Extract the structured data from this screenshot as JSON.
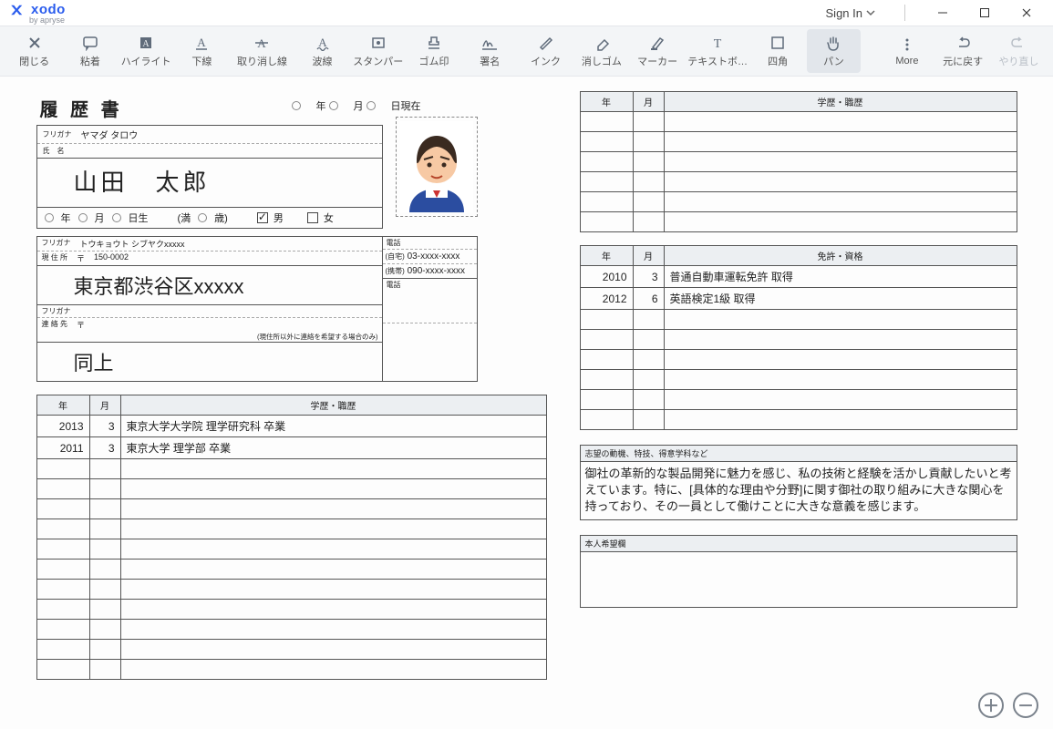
{
  "app": {
    "brand_name": "xodo",
    "brand_sub": "by apryse",
    "signin_label": "Sign In"
  },
  "toolbar": {
    "close": "閉じる",
    "sticky": "粘着",
    "highlight": "ハイライト",
    "underline": "下線",
    "strike": "取り消し線",
    "squiggly": "波線",
    "stamp": "スタンパー",
    "rubber": "ゴム印",
    "sign": "署名",
    "ink": "インク",
    "eraser": "消しゴム",
    "marker": "マーカー",
    "textbox": "テキストボ…",
    "rect": "四角",
    "pan": "パン",
    "more": "More",
    "undo": "元に戻す",
    "redo": "やり直し"
  },
  "resume": {
    "title": "履 歴 書",
    "date_suffix": {
      "y": "年",
      "m": "月",
      "d": "日現在"
    },
    "furigana_label": "フリガナ",
    "name_label": "氏　名",
    "furigana_value": "ヤマダ タロウ",
    "name_value": "山田　太郎",
    "dob": {
      "y": "年",
      "m": "月",
      "d": "日生",
      "age_pre": "(満",
      "age_post": "歳)",
      "male": "男",
      "female": "女",
      "male_checked": true
    },
    "addr": {
      "furigana": "トウキョウト シブヤクxxxxx",
      "label": "現 住 所",
      "postmark": "〒",
      "postcode": "150-0002",
      "value": "東京都渋谷区xxxxx",
      "tel_label": "電話",
      "tel_home_kind": "(自宅)",
      "tel_home": "03-xxxx-xxxx",
      "tel_mobile_kind": "(携帯)",
      "tel_mobile": "090-xxxx-xxxx"
    },
    "contact2": {
      "furigana_label": "フリガナ",
      "label": "連 絡 先",
      "postmark": "〒",
      "note": "(現住所以外に連絡を希望する場合のみ)",
      "value": "同上",
      "tel_label": "電話"
    },
    "hist_header": {
      "y": "年",
      "m": "月",
      "title": "学歴・職歴"
    },
    "education": [
      {
        "y": "2013",
        "m": "3",
        "t": "東京大学大学院 理学研究科 卒業"
      },
      {
        "y": "2011",
        "m": "3",
        "t": "東京大学 理学部 卒業"
      }
    ],
    "education_blank_rows": 11,
    "right_hist_blank_rows": 6,
    "license_header": {
      "y": "年",
      "m": "月",
      "title": "免許・資格"
    },
    "licenses": [
      {
        "y": "2010",
        "m": "3",
        "t": "普通自動車運転免許 取得"
      },
      {
        "y": "2012",
        "m": "6",
        "t": "英語検定1級 取得"
      }
    ],
    "license_blank_rows": 6,
    "motive_header": "志望の動機、特技、得意学科など",
    "motive_body": "御社の革新的な製品開発に魅力を感じ、私の技術と経験を活かし貢献したいと考えています。特に、[具体的な理由や分野]に関す御社の取り組みに大きな関心を持っており、その一員として働けことに大きな意義を感じます。",
    "wish_header": "本人希望欄"
  }
}
